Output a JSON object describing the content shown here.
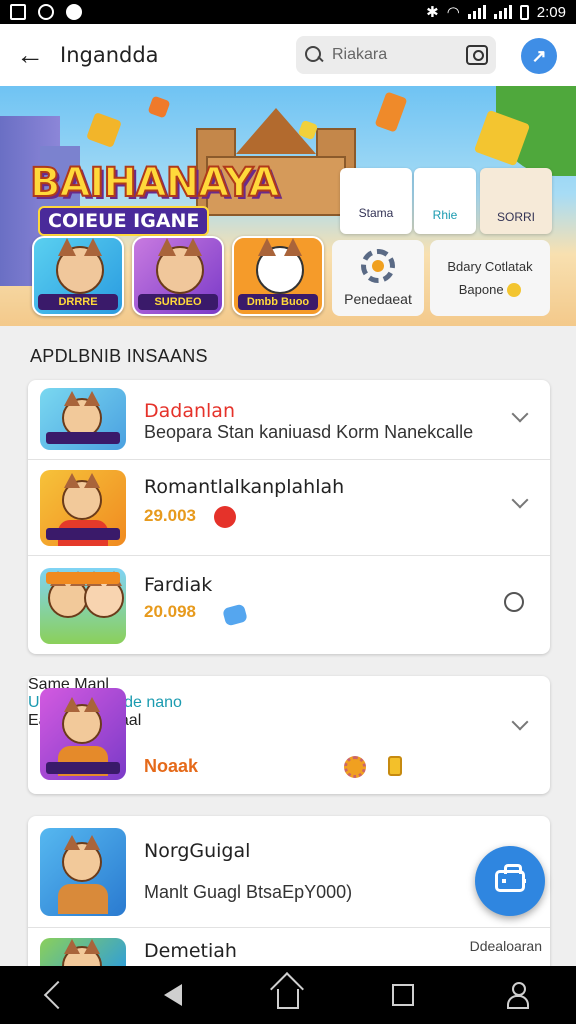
{
  "status_bar": {
    "time": "2:09"
  },
  "header": {
    "title": "Ingandda",
    "search_placeholder": "Riakara"
  },
  "banner": {
    "title": "BAIHANAYA",
    "subtitle": "COIEUE IGANE",
    "mini_cards": [
      "Stama",
      "Rhie",
      "SORRI"
    ],
    "tiles": [
      "DRRRE",
      "SURDEO",
      "Dmbb Buoo"
    ],
    "side_cards": [
      {
        "label": "Penedaeat"
      },
      {
        "line1": "Bdary Cotlatak",
        "line2": "Bapone"
      }
    ]
  },
  "section": {
    "title": "APDLBNIB INSAANS"
  },
  "list": [
    {
      "title": "Dadanlan",
      "subtitle": "Beopara Stan kaniuasd Korm Nanekcalle",
      "control": "chevron"
    },
    {
      "title": "Romantlalkanplahlah",
      "value": "29.003",
      "control": "chevron"
    },
    {
      "title": "Fardiak",
      "value": "20.098",
      "control": "radio"
    }
  ],
  "card2": {
    "title": "Same Manl",
    "subtitle": "Unaaar dlenade nano",
    "tag": "Noaak",
    "detail": "Eanae IVurtsaal"
  },
  "card3": [
    {
      "title": "NorgGuigal",
      "subtitle": "Manlt Guagl BtsaEpY000)"
    },
    {
      "title": "Demetiah",
      "side": "Ddealoaran"
    }
  ],
  "colors": {
    "accent": "#2f86e0",
    "highlight_red": "#e5322a",
    "value_orange": "#e79a1d",
    "teal": "#1b9bb0"
  }
}
